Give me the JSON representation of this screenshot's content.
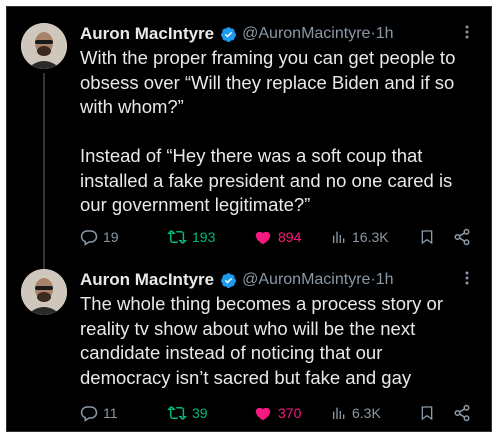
{
  "tweets": [
    {
      "author": "Auron MacIntyre",
      "handle": "@AuronMacintyre",
      "time": "1h",
      "text": "With the proper framing you can get people to\nobsess over “Will they replace Biden and if so\nwith whom?”\n\nInstead of “Hey there was a soft coup that\ninstalled a fake president and no one cared is\nour government legitimate?”",
      "replies": "19",
      "reposts": "193",
      "likes": "894",
      "views": "16.3K"
    },
    {
      "author": "Auron MacIntyre",
      "handle": "@AuronMacintyre",
      "time": "1h",
      "text": "The whole thing becomes a process story or\nreality tv show about who will be the next\ncandidate instead of noticing that our\ndemocracy isn’t sacred but fake and gay",
      "replies": "11",
      "reposts": "39",
      "likes": "370",
      "views": "6.3K"
    }
  ],
  "separator": " · ",
  "colors": {
    "background": "#000000",
    "text": "#e7e9ea",
    "muted": "#8b98a5",
    "verified": "#1d9bf0",
    "repost": "#00ba7c",
    "like": "#f91880"
  },
  "icons": [
    "verified-badge-icon",
    "more-icon",
    "reply-icon",
    "repost-icon",
    "like-icon",
    "views-icon",
    "bookmark-icon",
    "share-icon"
  ]
}
